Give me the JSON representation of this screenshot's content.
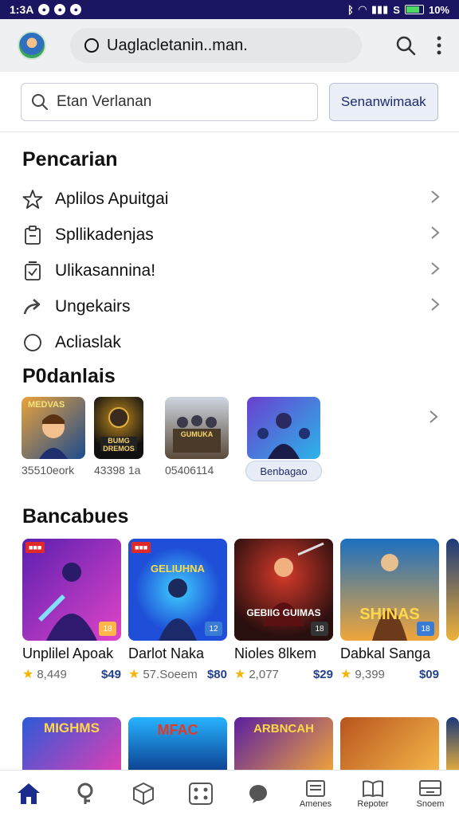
{
  "status_bar": {
    "time": "1:3A",
    "battery": "10%",
    "signal_letter": "S"
  },
  "browser": {
    "url": "Uaglacletanin..man.",
    "icons": [
      "avatar",
      "lock-icon",
      "search-icon",
      "more-vert-icon"
    ]
  },
  "search": {
    "placeholder": "Etan Verlanan",
    "button_label": "Senanwimaak"
  },
  "pencarian": {
    "title": "Pencarian",
    "items": [
      {
        "label": "Aplilos Apuitgai",
        "icon": "star-icon"
      },
      {
        "label": "Spllikadenjas",
        "icon": "clipboard-icon"
      },
      {
        "label": "Ulikasannina!",
        "icon": "checklist-icon"
      },
      {
        "label": "Ungekairs",
        "icon": "share-arrow-icon"
      },
      {
        "label": "Acliaslak",
        "icon": "circle-icon"
      }
    ]
  },
  "popular": {
    "title": "P0danlais",
    "items": [
      {
        "caption": "35510eork",
        "art_label": "MEDVAS",
        "colors": [
          "#e9a23b",
          "#1b4a8f"
        ]
      },
      {
        "caption": "43398 1a",
        "art_label": "BUMG DREMOS",
        "colors": [
          "#111111",
          "#c08a1e"
        ]
      },
      {
        "caption": "05406114",
        "art_label": "GUMUKA",
        "colors": [
          "#cfd6e0",
          "#5b4a3a"
        ]
      },
      {
        "caption": "",
        "art_label": "",
        "colors": [
          "#6a3fd0",
          "#2bb5e8"
        ]
      }
    ],
    "chip_label": "Benbagao"
  },
  "bancabues": {
    "title": "Bancabues",
    "cards": [
      {
        "title": "Unplilel Apoak",
        "rating": "8,449",
        "price": "$49",
        "art_label": "",
        "colors": [
          "#5a1fb0",
          "#e044c8"
        ]
      },
      {
        "title": "Darlot Naka",
        "rating": "57.Soeem",
        "price": "$80",
        "art_label": "GELIUHNA",
        "colors": [
          "#1f4fd8",
          "#3fd0ff"
        ]
      },
      {
        "title": "Nioles 8lkem",
        "rating": "2,077",
        "price": "$29",
        "art_label": "GEBIIG GUIMAS",
        "colors": [
          "#2a0f0f",
          "#d63a2a"
        ]
      },
      {
        "title": "Dabkal Sanga",
        "rating": "9,399",
        "price": "$09",
        "art_label": "SHINAS",
        "colors": [
          "#1c6fc0",
          "#f0a63a"
        ]
      }
    ],
    "more_cards": [
      {
        "art_label": "MIGHMS",
        "colors": [
          "#2c5ad8",
          "#e23fb5"
        ]
      },
      {
        "art_label": "MFAC",
        "colors": [
          "#0b3a8a",
          "#27b3ff"
        ]
      },
      {
        "art_label": "ARBNCAH",
        "colors": [
          "#5a1fa0",
          "#f2a53a"
        ]
      },
      {
        "art_label": "",
        "colors": [
          "#b8541e",
          "#f5b84a"
        ]
      }
    ]
  },
  "bottom_nav": [
    {
      "label": "",
      "icon": "home-icon"
    },
    {
      "label": "",
      "icon": "key-icon"
    },
    {
      "label": "",
      "icon": "cube-icon"
    },
    {
      "label": "",
      "icon": "dice-icon"
    },
    {
      "label": "",
      "icon": "chat-bubble-icon"
    },
    {
      "label": "Amenes",
      "icon": "list-icon"
    },
    {
      "label": "Repoter",
      "icon": "book-icon"
    },
    {
      "label": "Snoem",
      "icon": "tray-icon"
    }
  ],
  "colors": {
    "status_bar": "#1a1560",
    "accent": "#24418f",
    "star": "#f5b400",
    "active_nav": "#1a2c8c"
  }
}
